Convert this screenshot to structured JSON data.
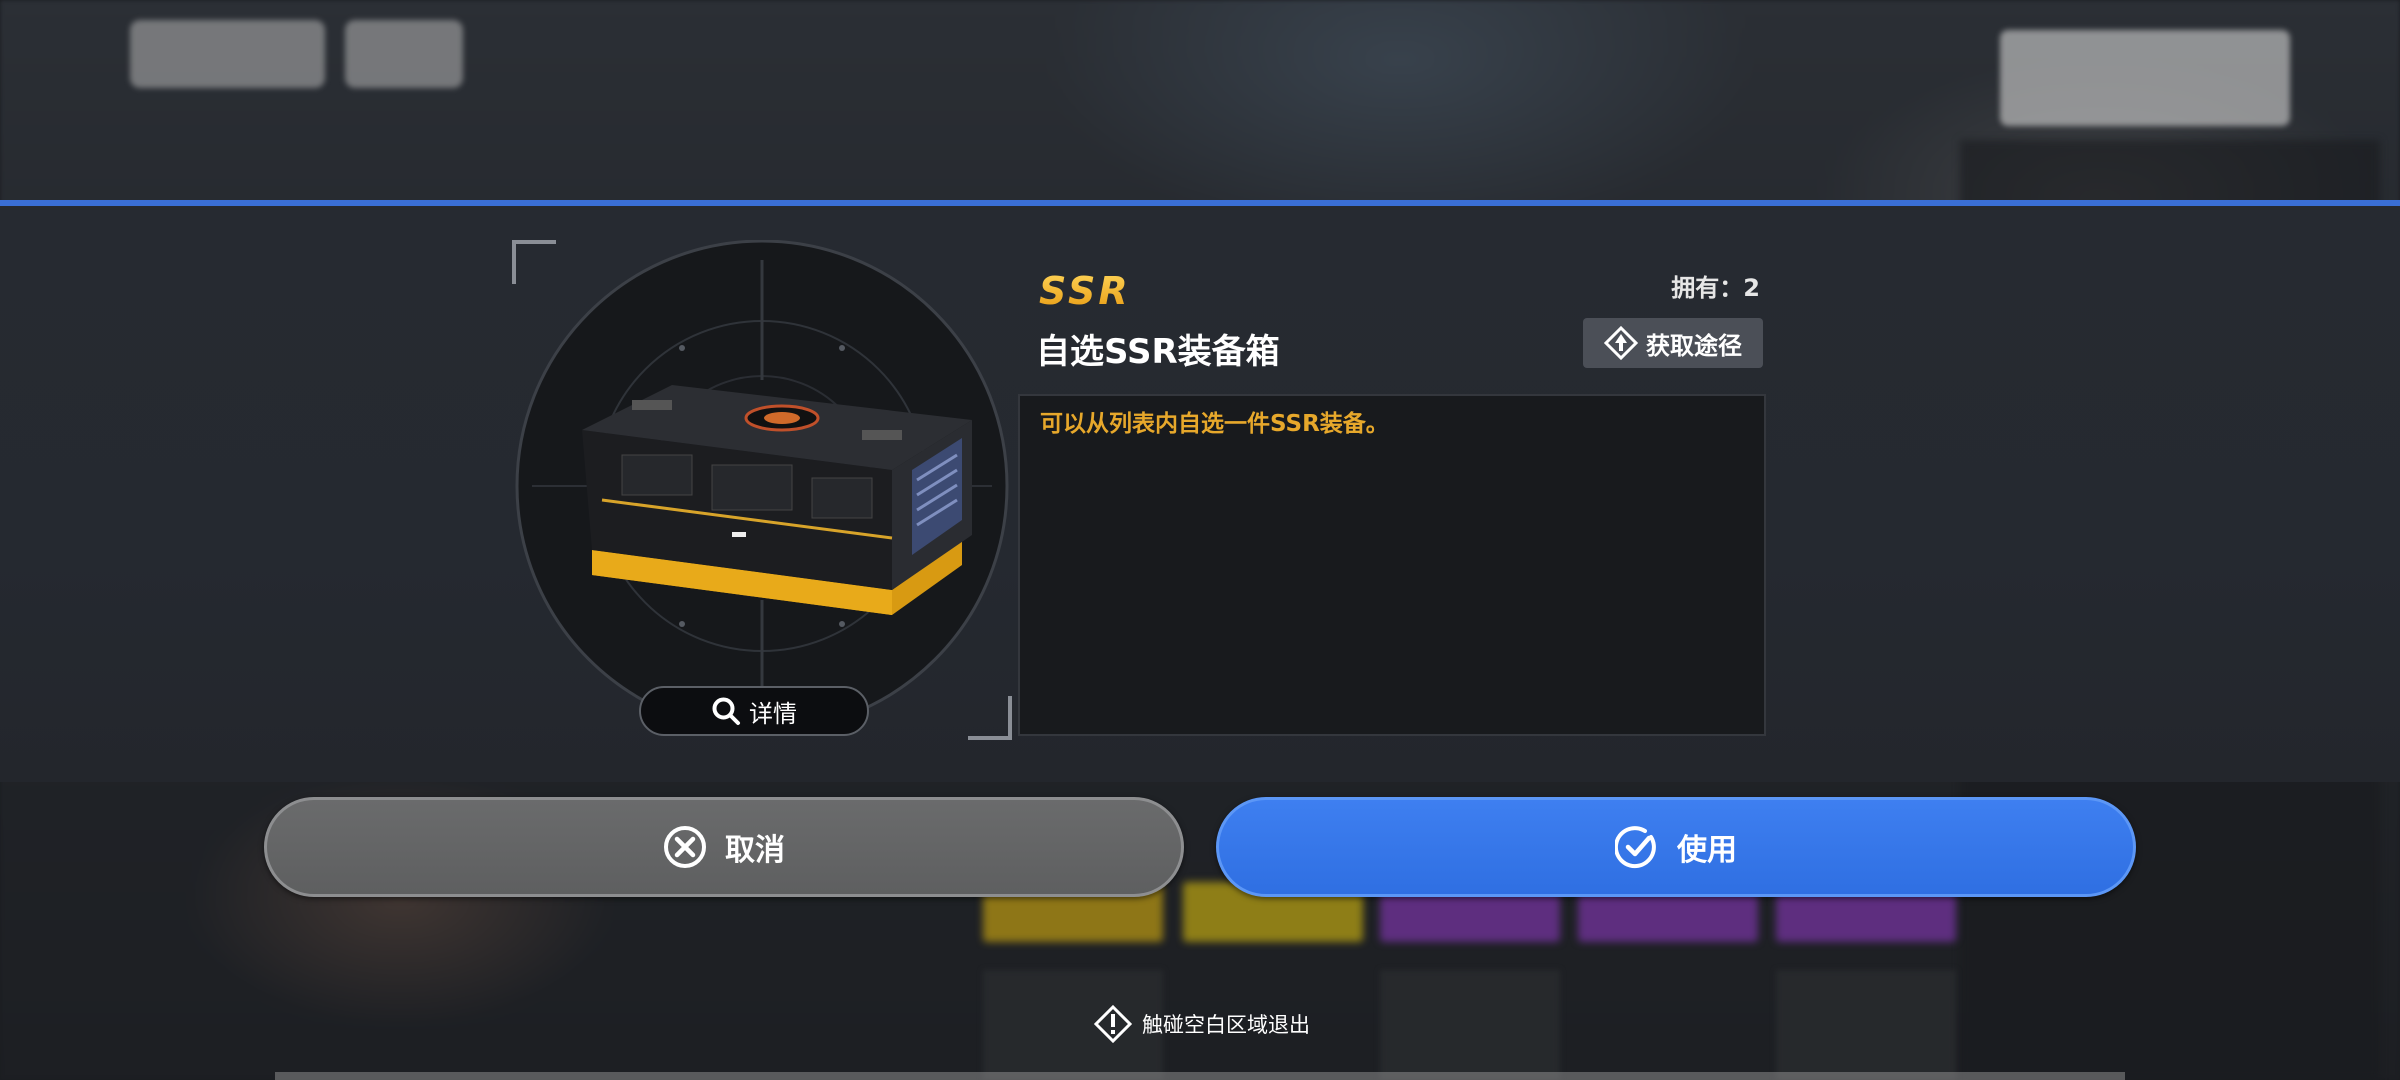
{
  "dialog": {
    "rarity": "SSR",
    "owned_label": "拥有：2",
    "item_name": "自选SSR装备箱",
    "source_button": "获取途径",
    "description": "可以从列表内自选一件SSR装备。",
    "detail_button": "详情"
  },
  "actions": {
    "cancel_label": "取消",
    "use_label": "使用"
  },
  "hint": "触碰空白区域退出",
  "colors": {
    "accent_blue": "#3a6fd6",
    "rarity_gold": "#f0b32a",
    "description_text": "#e7a82b",
    "use_button": "#3e7ff0",
    "cancel_button": "#646566"
  },
  "icons": {
    "detail": "magnifier-icon",
    "source": "diamond-arrow-icon",
    "cancel": "x-circle-icon",
    "use": "check-circle-icon",
    "hint": "warning-diamond-icon"
  }
}
